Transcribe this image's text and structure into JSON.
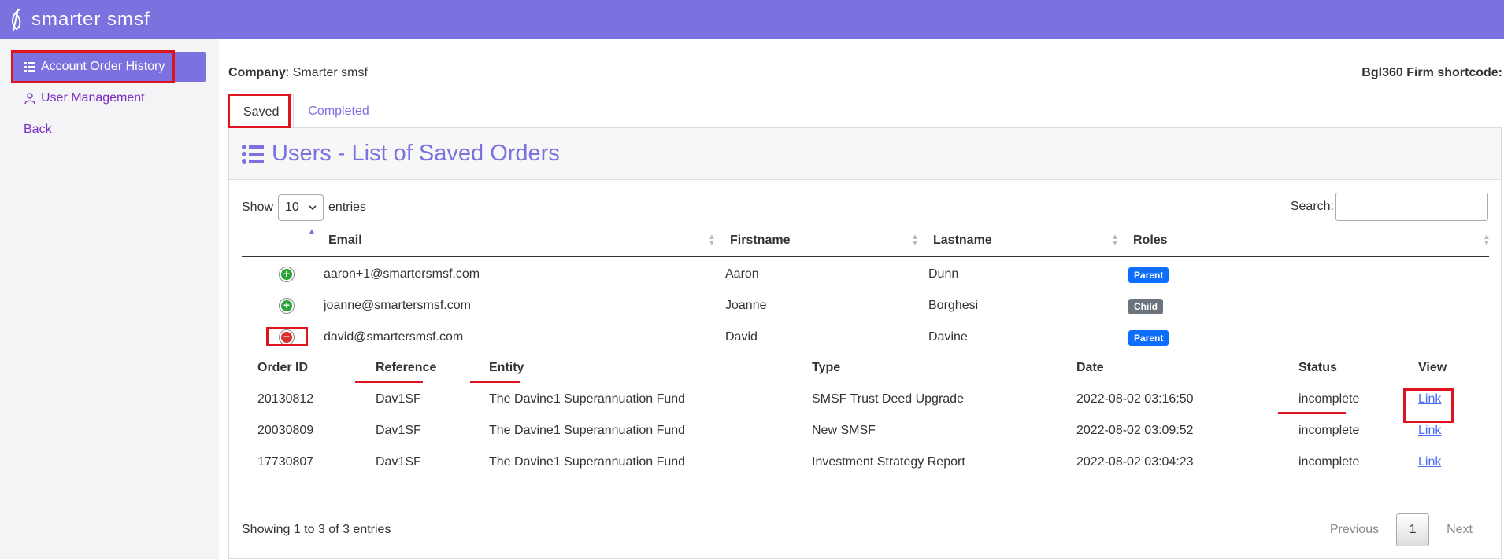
{
  "app": {
    "name": "smarter smsf"
  },
  "sidebar": {
    "items": [
      {
        "label": "Account Order History"
      },
      {
        "label": "User Management"
      },
      {
        "label": "Back"
      }
    ]
  },
  "header": {
    "company_label": "Company",
    "company_value": "Smarter smsf",
    "shortcode_label": "Bgl360 Firm shortcode:"
  },
  "tabs": [
    {
      "label": "Saved"
    },
    {
      "label": "Completed"
    }
  ],
  "panel": {
    "title": "Users - List of Saved Orders"
  },
  "table_controls": {
    "show_label": "Show",
    "entries_value": "10",
    "entries_label": "entries",
    "search_label": "Search:"
  },
  "table": {
    "columns": [
      "Email",
      "Firstname",
      "Lastname",
      "Roles"
    ],
    "rows": [
      {
        "email": "aaron+1@smartersmsf.com",
        "firstname": "Aaron",
        "lastname": "Dunn",
        "role": "Parent"
      },
      {
        "email": "joanne@smartersmsf.com",
        "firstname": "Joanne",
        "lastname": "Borghesi",
        "role": "Child"
      },
      {
        "email": "david@smartersmsf.com",
        "firstname": "David",
        "lastname": "Davine",
        "role": "Parent"
      }
    ]
  },
  "orders": {
    "columns": [
      "Order ID",
      "Reference",
      "Entity",
      "Type",
      "Date",
      "Status",
      "View"
    ],
    "rows": [
      {
        "order_id": "20130812",
        "reference": "Dav1SF",
        "entity": "The Davine1 Superannuation Fund",
        "type": "SMSF Trust Deed Upgrade",
        "date": "2022-08-02 03:16:50",
        "status": "incomplete",
        "view": "Link"
      },
      {
        "order_id": "20030809",
        "reference": "Dav1SF",
        "entity": "The Davine1 Superannuation Fund",
        "type": "New SMSF",
        "date": "2022-08-02 03:09:52",
        "status": "incomplete",
        "view": "Link"
      },
      {
        "order_id": "17730807",
        "reference": "Dav1SF",
        "entity": "The Davine1 Superannuation Fund",
        "type": "Investment Strategy Report",
        "date": "2022-08-02 03:04:23",
        "status": "incomplete",
        "view": "Link"
      }
    ]
  },
  "footer": {
    "info": "Showing 1 to 3 of 3 entries",
    "previous": "Previous",
    "current_page": "1",
    "next": "Next"
  },
  "colors": {
    "brand": "#7b72e0",
    "highlight": "#e0141e",
    "badge_parent": "#0d6efd",
    "badge_child": "#6c757d"
  }
}
